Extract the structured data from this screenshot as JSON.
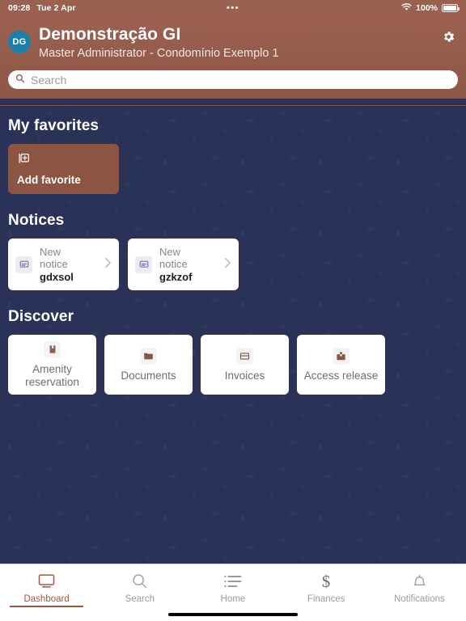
{
  "status_bar": {
    "time": "09:28",
    "date": "Tue 2 Apr",
    "center_dots": "•••",
    "battery_percent": "100%",
    "wifi_icon": "wifi-icon",
    "battery_icon": "battery-icon"
  },
  "header": {
    "avatar_initials": "DG",
    "title": "Demonstração GI",
    "subtitle": "Master Administrator - Condomínio Exemplo 1",
    "settings_icon": "gear-icon",
    "accent_color": "#8d5645"
  },
  "search": {
    "placeholder": "Search",
    "value": "",
    "icon": "search-icon"
  },
  "favorites": {
    "section_title": "My favorites",
    "add_card": {
      "label": "Add favorite",
      "icon": "add-square-icon",
      "color": "#8c5443"
    }
  },
  "notices": {
    "section_title": "Notices",
    "items": [
      {
        "kicker_line1": "New",
        "kicker_line2": "notice",
        "name": "gdxsol",
        "icon": "message-icon",
        "chevron": "chevron-right-icon"
      },
      {
        "kicker_line1": "New",
        "kicker_line2": "notice",
        "name": "gzkzof",
        "icon": "message-icon",
        "chevron": "chevron-right-icon"
      }
    ]
  },
  "discover": {
    "section_title": "Discover",
    "items": [
      {
        "label": "Amenity reservation",
        "icon": "book-icon"
      },
      {
        "label": "Documents",
        "icon": "folder-icon"
      },
      {
        "label": "Invoices",
        "icon": "credit-card-icon"
      },
      {
        "label": "Access release",
        "icon": "id-badge-icon"
      }
    ]
  },
  "tabbar": {
    "active_color": "#9d5744",
    "inactive_color": "#9a9aa0",
    "tabs": [
      {
        "label": "Dashboard",
        "icon": "monitor-icon",
        "active": true
      },
      {
        "label": "Search",
        "icon": "search-icon",
        "active": false
      },
      {
        "label": "Home",
        "icon": "list-icon",
        "active": false
      },
      {
        "label": "Finances",
        "icon": "dollar-icon",
        "active": false
      },
      {
        "label": "Notifications",
        "icon": "bell-icon",
        "active": false
      }
    ]
  },
  "background": {
    "color": "#2b3258"
  }
}
